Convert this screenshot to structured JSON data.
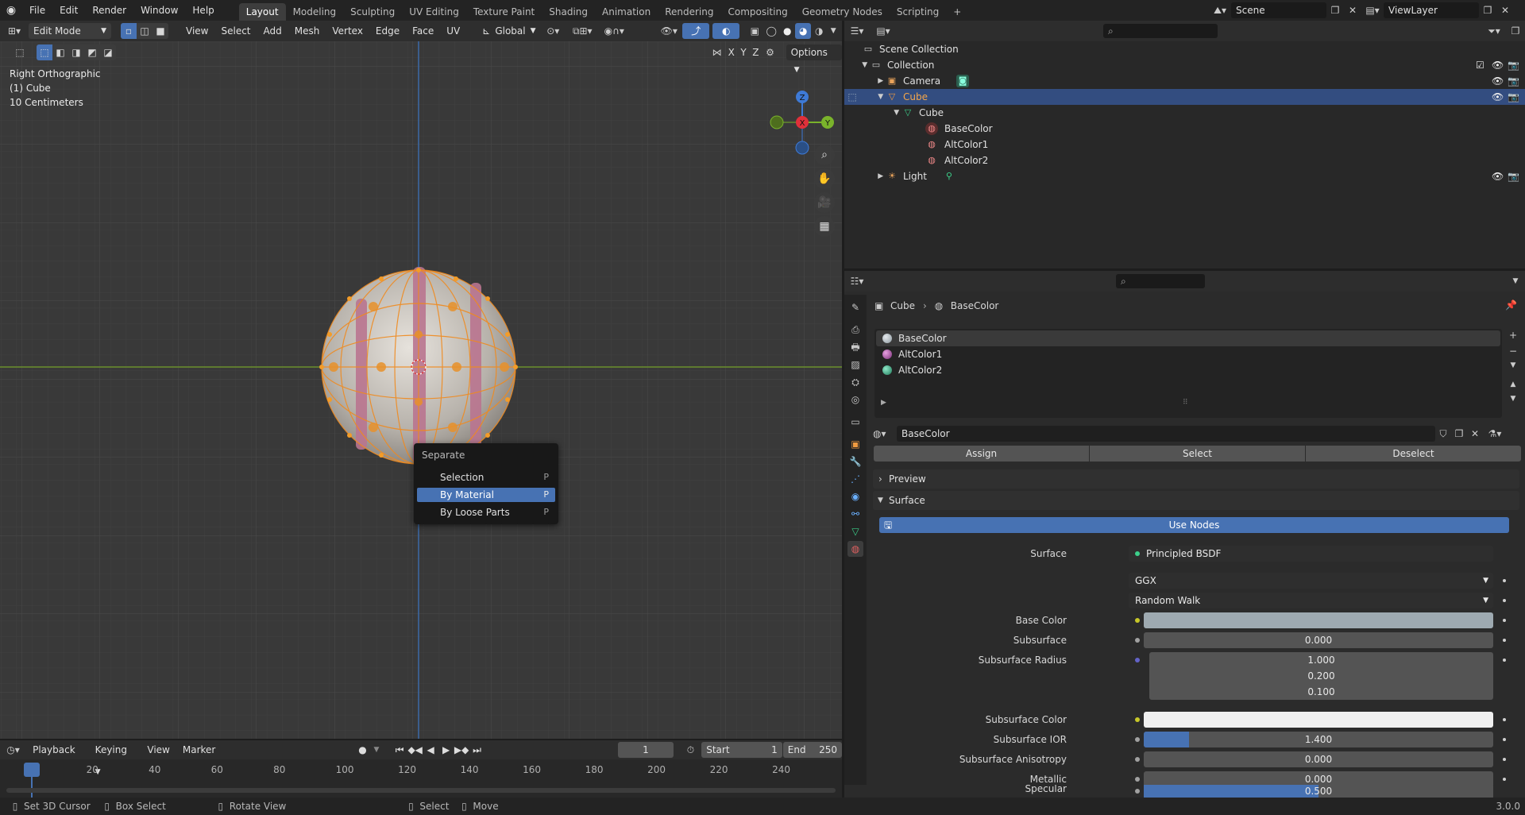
{
  "topbar": {
    "menus": [
      "File",
      "Edit",
      "Render",
      "Window",
      "Help"
    ],
    "workspaces": [
      "Layout",
      "Modeling",
      "Sculpting",
      "UV Editing",
      "Texture Paint",
      "Shading",
      "Animation",
      "Rendering",
      "Compositing",
      "Geometry Nodes",
      "Scripting"
    ],
    "active_workspace": "Layout",
    "add_tab": "+",
    "scene": "Scene",
    "view_layer": "ViewLayer"
  },
  "viewport": {
    "mode": "Edit Mode",
    "menus": [
      "View",
      "Select",
      "Add",
      "Mesh",
      "Vertex",
      "Edge",
      "Face",
      "UV"
    ],
    "transform": "Global",
    "axes": [
      "X",
      "Y",
      "Z"
    ],
    "options": "Options",
    "info": {
      "view": "Right Orthographic",
      "object": "(1) Cube",
      "scale": "10 Centimeters"
    },
    "gizmo": {
      "z": "Z",
      "x": "X",
      "y": "Y"
    }
  },
  "context_menu": {
    "title": "Separate",
    "items": [
      {
        "label": "Selection",
        "key": "P"
      },
      {
        "label": "By Material",
        "key": "P"
      },
      {
        "label": "By Loose Parts",
        "key": "P"
      }
    ],
    "selected_index": 1
  },
  "outliner": {
    "rows": [
      {
        "label": "Scene Collection"
      },
      {
        "label": "Collection"
      },
      {
        "label": "Camera"
      },
      {
        "label": "Cube"
      },
      {
        "label": "Cube"
      },
      {
        "label": "BaseColor"
      },
      {
        "label": "AltColor1"
      },
      {
        "label": "AltColor2"
      },
      {
        "label": "Light"
      }
    ]
  },
  "properties": {
    "breadcrumb": {
      "object": "Cube",
      "material": "BaseColor"
    },
    "slots": [
      "BaseColor",
      "AltColor1",
      "AltColor2"
    ],
    "material_name": "BaseColor",
    "buttons": {
      "assign": "Assign",
      "select": "Select",
      "deselect": "Deselect"
    },
    "panels": {
      "preview": "Preview",
      "surface": "Surface"
    },
    "use_nodes": "Use Nodes",
    "surface": {
      "label": "Surface",
      "value": "Principled BSDF"
    },
    "distribution": "GGX",
    "subsurface_method": "Random Walk",
    "fields": {
      "base_color": "Base Color",
      "subsurface": {
        "label": "Subsurface",
        "value": "0.000"
      },
      "subsurface_radius": {
        "label": "Subsurface Radius",
        "values": [
          "1.000",
          "0.200",
          "0.100"
        ]
      },
      "subsurface_color": "Subsurface Color",
      "subsurface_ior": {
        "label": "Subsurface IOR",
        "value": "1.400",
        "fill": 0.13
      },
      "subsurface_anisotropy": {
        "label": "Subsurface Anisotropy",
        "value": "0.000"
      },
      "metallic": {
        "label": "Metallic",
        "value": "0.000"
      },
      "specular": {
        "label": "Specular",
        "value": "0.500",
        "fill": 0.5
      }
    },
    "colors": {
      "base_color": "#9eaab1",
      "subsurface_color": "#f0f0f0",
      "accent": "#4772b3"
    }
  },
  "timeline": {
    "menus": [
      "Playback",
      "Keying",
      "View",
      "Marker"
    ],
    "current_frame": "1",
    "start_label": "Start",
    "start": "1",
    "end_label": "End",
    "end": "250",
    "frame_labels": [
      "1",
      "20",
      "40",
      "60",
      "80",
      "100",
      "120",
      "140",
      "160",
      "180",
      "200",
      "220",
      "240"
    ]
  },
  "status": {
    "items": [
      "Set 3D Cursor",
      "Box Select",
      "Rotate View",
      "Select",
      "Move"
    ],
    "version": "3.0.0"
  }
}
